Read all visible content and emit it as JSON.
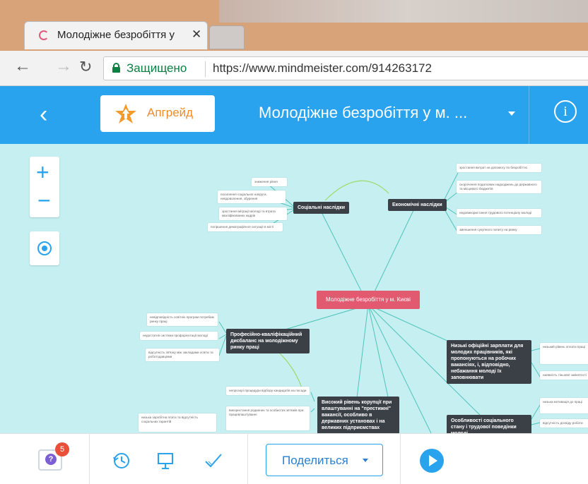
{
  "browser": {
    "tab_title": "Молодіжне безробіття у",
    "tab_close": "✕",
    "secure_label": "Защищено",
    "url": "https://www.mindmeister.com/914263172"
  },
  "appbar": {
    "back": "‹",
    "upgrade_label": "Апгрейд",
    "map_title": "Молодіжне безробіття у м. ...",
    "info": "i"
  },
  "canvas": {
    "zoom_in": "+",
    "zoom_out": "−",
    "root_label": "Молодіжне безробіття у м. Києві",
    "branches": {
      "social": "Соціальні наслідки",
      "economic": "Економічні наслідки",
      "professional": "Професійно-кваліфікаційний дисбаланс на молодіжному ринку праці",
      "corruption": "Високий рівень корупції при влаштуванні на \"престижні\" вакансії, особливо в державних установах і на великих підприємствах",
      "wages": "Низькі офіційні зарплати для молодих працівників, які пропонуються на робочих вакансіях, і, відповідно, небажання молоді їх заповнювати",
      "features": "Особливості соціального стану і трудової поведінки молоді"
    },
    "leaves": {
      "social": [
        "зниження рівня",
        "посилення соціальної напруги, невдоволення, збурення",
        "зростання міграції молоді та втрата кваліфікованих кадрів",
        "погіршення демографічної ситуації в місті"
      ],
      "economic": [
        "зростання витрат на допомогу по безробіттю",
        "скорочення податкових надходжень до державного та місцевого бюджетів",
        "недовикористання трудового потенціалу молоді",
        "зменшення сукупного попиту на ринку"
      ],
      "professional": [
        "невідповідність освітніх програм потребам ринку праці",
        "недостатня система профорієнтації молоді",
        "відсутність зв'язку між закладами освіти та роботодавцями"
      ],
      "corruption": [
        "непрозорі процедури відбору кандидатів на посади",
        "використання родинних та особистих зв'язків при працевлаштуванні"
      ],
      "wages": [
        "низький рівень оплати праці",
        "наявність тіньової зайнятості"
      ],
      "features": [
        "низька мотивація до праці",
        "відсутність досвіду роботи"
      ],
      "other": [
        "низька заробітна плата та відсутність соціальних гарантій"
      ]
    }
  },
  "bottombar": {
    "help_badge": "5",
    "help_glyph": "?",
    "share_label": "Поделиться"
  }
}
